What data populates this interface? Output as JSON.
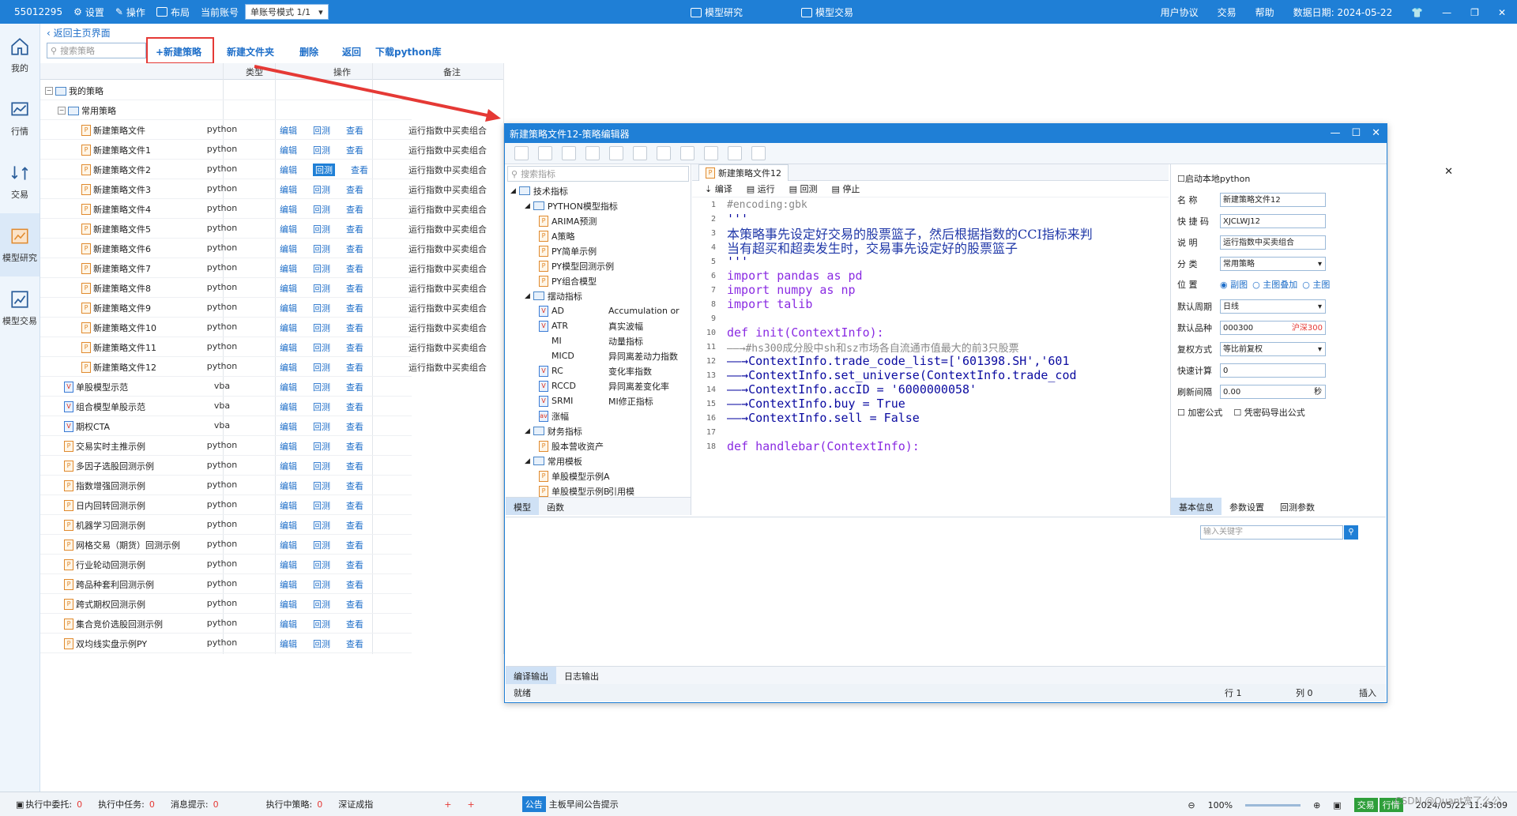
{
  "topbar": {
    "account_id": "55012295",
    "settings": "设置",
    "operate": "操作",
    "layout": "布局",
    "current_account_label": "当前账号",
    "mode_select": "单账号模式 1/1",
    "center_tabs": [
      "模型研究",
      "模型交易"
    ],
    "user_agreement": "用户协议",
    "trade": "交易",
    "help": "帮助",
    "data_date": "数据日期: 2024-05-22"
  },
  "leftnav": [
    {
      "label": "我的",
      "icon": "home-icon"
    },
    {
      "label": "行情",
      "icon": "chart-icon"
    },
    {
      "label": "交易",
      "icon": "exchange-icon"
    },
    {
      "label": "模型研究",
      "icon": "research-icon"
    },
    {
      "label": "模型交易",
      "icon": "model-trade-icon"
    }
  ],
  "main": {
    "back_link": "返回主页界面",
    "search_placeholder": "搜索策略",
    "toolbar": {
      "new_strategy": "+新建策略",
      "new_folder": "新建文件夹",
      "delete": "删除",
      "back": "返回",
      "download_python": "下载python库"
    },
    "columns": {
      "type": "类型",
      "ops": "操作",
      "note": "备注"
    },
    "ops_labels": {
      "edit": "编辑",
      "backtest": "回测",
      "view": "查看"
    },
    "root_folder": "我的策略",
    "sub_folder": "常用策略",
    "rows": [
      {
        "name": "新建策略文件",
        "type": "python",
        "note": "运行指数中买卖组合",
        "indent": 2,
        "icon": "p"
      },
      {
        "name": "新建策略文件1",
        "type": "python",
        "note": "运行指数中买卖组合",
        "indent": 2,
        "icon": "p"
      },
      {
        "name": "新建策略文件2",
        "type": "python",
        "note": "运行指数中买卖组合",
        "indent": 2,
        "icon": "p",
        "active": true
      },
      {
        "name": "新建策略文件3",
        "type": "python",
        "note": "运行指数中买卖组合",
        "indent": 2,
        "icon": "p"
      },
      {
        "name": "新建策略文件4",
        "type": "python",
        "note": "运行指数中买卖组合",
        "indent": 2,
        "icon": "p"
      },
      {
        "name": "新建策略文件5",
        "type": "python",
        "note": "运行指数中买卖组合",
        "indent": 2,
        "icon": "p"
      },
      {
        "name": "新建策略文件6",
        "type": "python",
        "note": "运行指数中买卖组合",
        "indent": 2,
        "icon": "p"
      },
      {
        "name": "新建策略文件7",
        "type": "python",
        "note": "运行指数中买卖组合",
        "indent": 2,
        "icon": "p"
      },
      {
        "name": "新建策略文件8",
        "type": "python",
        "note": "运行指数中买卖组合",
        "indent": 2,
        "icon": "p"
      },
      {
        "name": "新建策略文件9",
        "type": "python",
        "note": "运行指数中买卖组合",
        "indent": 2,
        "icon": "p"
      },
      {
        "name": "新建策略文件10",
        "type": "python",
        "note": "运行指数中买卖组合",
        "indent": 2,
        "icon": "p"
      },
      {
        "name": "新建策略文件11",
        "type": "python",
        "note": "运行指数中买卖组合",
        "indent": 2,
        "icon": "p"
      },
      {
        "name": "新建策略文件12",
        "type": "python",
        "note": "运行指数中买卖组合",
        "indent": 2,
        "icon": "p"
      },
      {
        "name": "单股模型示范",
        "type": "vba",
        "note": "",
        "indent": 1,
        "icon": "v"
      },
      {
        "name": "组合模型单股示范",
        "type": "vba",
        "note": "",
        "indent": 1,
        "icon": "v"
      },
      {
        "name": "期权CTA",
        "type": "vba",
        "note": "",
        "indent": 1,
        "icon": "v"
      },
      {
        "name": "交易实时主推示例",
        "type": "python",
        "note": "",
        "indent": 1,
        "icon": "p"
      },
      {
        "name": "多因子选股回测示例",
        "type": "python",
        "note": "",
        "indent": 1,
        "icon": "p"
      },
      {
        "name": "指数增强回测示例",
        "type": "python",
        "note": "",
        "indent": 1,
        "icon": "p"
      },
      {
        "name": "日内回转回测示例",
        "type": "python",
        "note": "",
        "indent": 1,
        "icon": "p"
      },
      {
        "name": "机器学习回测示例",
        "type": "python",
        "note": "",
        "indent": 1,
        "icon": "p"
      },
      {
        "name": "网格交易（期货）回测示例",
        "type": "python",
        "note": "",
        "indent": 1,
        "icon": "p"
      },
      {
        "name": "行业轮动回测示例",
        "type": "python",
        "note": "",
        "indent": 1,
        "icon": "p"
      },
      {
        "name": "跨品种套利回测示例",
        "type": "python",
        "note": "",
        "indent": 1,
        "icon": "p"
      },
      {
        "name": "跨式期权回测示例",
        "type": "python",
        "note": "",
        "indent": 1,
        "icon": "p"
      },
      {
        "name": "集合竞价选股回测示例",
        "type": "python",
        "note": "",
        "indent": 1,
        "icon": "p"
      },
      {
        "name": "双均线实盘示例PY",
        "type": "python",
        "note": "",
        "indent": 1,
        "icon": "p"
      }
    ]
  },
  "editor": {
    "title": "新建策略文件12-策略编辑器",
    "indicator_search": "搜索指标",
    "indicators": [
      {
        "label": "技术指标",
        "level": 0,
        "kind": "folder",
        "expanded": true
      },
      {
        "label": "PYTHON模型指标",
        "level": 1,
        "kind": "folder",
        "expanded": true
      },
      {
        "label": "ARIMA预测",
        "level": 2,
        "kind": "p"
      },
      {
        "label": "A策略",
        "level": 2,
        "kind": "p"
      },
      {
        "label": "PY简单示例",
        "level": 2,
        "kind": "p"
      },
      {
        "label": "PY模型回测示例",
        "level": 2,
        "kind": "p"
      },
      {
        "label": "PY组合模型",
        "level": 2,
        "kind": "p"
      },
      {
        "label": "摆动指标",
        "level": 1,
        "kind": "folder",
        "expanded": true
      },
      {
        "label": "AD",
        "desc": "Accumulation or",
        "level": 2,
        "kind": "v"
      },
      {
        "label": "ATR",
        "desc": "真实波幅",
        "level": 2,
        "kind": "v"
      },
      {
        "label": "MI",
        "desc": "动量指标",
        "level": 2,
        "kind": "none"
      },
      {
        "label": "MICD",
        "desc": "异同离差动力指数",
        "level": 2,
        "kind": "none"
      },
      {
        "label": "RC",
        "desc": "变化率指数",
        "level": 2,
        "kind": "v"
      },
      {
        "label": "RCCD",
        "desc": "异同离差变化率",
        "level": 2,
        "kind": "v"
      },
      {
        "label": "SRMI",
        "desc": "MI修正指标",
        "level": 2,
        "kind": "v"
      },
      {
        "label": "涨幅",
        "level": 2,
        "kind": "av"
      },
      {
        "label": "财务指标",
        "level": 1,
        "kind": "folder",
        "expanded": true
      },
      {
        "label": "股本营收资产",
        "level": 2,
        "kind": "p"
      },
      {
        "label": "常用模板",
        "level": 1,
        "kind": "folder",
        "expanded": true
      },
      {
        "label": "单股模型示例A",
        "level": 2,
        "kind": "p"
      },
      {
        "label": "单股模型示例B",
        "desc": "引用模",
        "level": 2,
        "kind": "p"
      }
    ],
    "left_tabs": [
      "模型",
      "函数"
    ],
    "file_tab": "新建策略文件12",
    "code_actions": [
      "编译",
      "运行",
      "回测",
      "停止"
    ],
    "code_lines": [
      {
        "n": "1",
        "t": "#encoding:gbk",
        "c": "cm"
      },
      {
        "n": "2",
        "t": "'''",
        "c": "str"
      },
      {
        "n": "3",
        "t": "本策略事先设定好交易的股票篮子，然后根据指数的CCI指标来判",
        "c": "cn"
      },
      {
        "n": "4",
        "t": "当有超买和超卖发生时，交易事先设定好的股票篮子",
        "c": "cn"
      },
      {
        "n": "5",
        "t": "'''",
        "c": "str"
      },
      {
        "n": "6",
        "t": "import pandas as pd",
        "c": "kw"
      },
      {
        "n": "7",
        "t": "import numpy as np",
        "c": "kw"
      },
      {
        "n": "8",
        "t": "import talib",
        "c": "kw"
      },
      {
        "n": "9",
        "t": "",
        "c": ""
      },
      {
        "n": "10",
        "t": "def init(ContextInfo):",
        "c": "kw"
      },
      {
        "n": "11",
        "t": "——→#hs300成分股中sh和sz市场各自流通市值最大的前3只股票",
        "c": "cm"
      },
      {
        "n": "12",
        "t": "——→ContextInfo.trade_code_list=['601398.SH','601",
        "c": "str"
      },
      {
        "n": "13",
        "t": "——→ContextInfo.set_universe(ContextInfo.trade_cod",
        "c": "str"
      },
      {
        "n": "14",
        "t": "——→ContextInfo.accID = '6000000058'",
        "c": "str"
      },
      {
        "n": "15",
        "t": "——→ContextInfo.buy = True",
        "c": "str"
      },
      {
        "n": "16",
        "t": "——→ContextInfo.sell = False",
        "c": "str"
      },
      {
        "n": "17",
        "t": "",
        "c": ""
      },
      {
        "n": "18",
        "t": "def handlebar(ContextInfo):",
        "c": "kw"
      }
    ],
    "props": {
      "start_local_python": "启动本地python",
      "name_label": "名  称",
      "name_value": "新建策略文件12",
      "shortcut_label": "快 捷 码",
      "shortcut_value": "XJCLWJ12",
      "desc_label": "说  明",
      "desc_value": "运行指数中买卖组合",
      "category_label": "分  类",
      "category_value": "常用策略",
      "position_label": "位  置",
      "position_options": [
        "副图",
        "主图叠加",
        "主图"
      ],
      "period_label": "默认周期",
      "period_value": "日线",
      "product_label": "默认品种",
      "product_value": "000300",
      "product_tag": "沪深300",
      "adjust_label": "复权方式",
      "adjust_value": "等比前复权",
      "quick_calc_label": "快速计算",
      "quick_calc_value": "0",
      "refresh_label": "刷新间隔",
      "refresh_value": "0.00",
      "refresh_unit": "秒",
      "encrypt_formula": "加密公式",
      "export_with_password": "凭密码导出公式",
      "tabs": [
        "基本信息",
        "参数设置",
        "回测参数"
      ],
      "keyword_placeholder": "输入关键字"
    },
    "output_tabs": [
      "编译输出",
      "日志输出"
    ],
    "status": {
      "state": "就绪",
      "row": "行 1",
      "col": "列 0",
      "mode": "插入"
    }
  },
  "statusbar": {
    "pending_orders_label": "执行中委托:",
    "pending_orders": "0",
    "pending_tasks_label": "执行中任务:",
    "pending_tasks": "0",
    "messages_label": "消息提示:",
    "messages": "0",
    "running_strategies_label": "执行中策略:",
    "running_strategies": "0",
    "index_name": "深证成指",
    "announce_tag": "公告",
    "announce_text": "主板早间公告提示",
    "zoom": "100%",
    "trade_tag": "交易",
    "market_tag": "行情",
    "datetime": "2024/05/22 11:43:09",
    "watermark": "CSDN @Quant宽了么公"
  }
}
